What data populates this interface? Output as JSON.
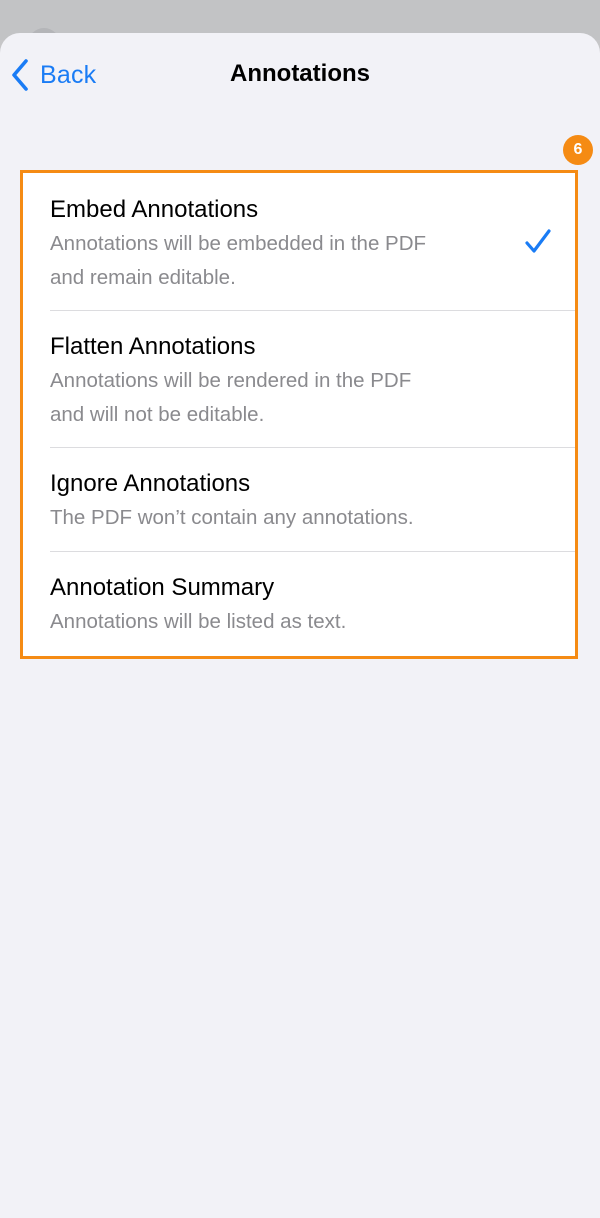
{
  "nav": {
    "back_label": "Back",
    "title": "Annotations"
  },
  "badge": "6",
  "options": [
    {
      "title": "Embed Annotations",
      "description_lines": [
        "Annotations will be embedded in the PDF",
        "and remain editable."
      ],
      "selected": true
    },
    {
      "title": "Flatten Annotations",
      "description_lines": [
        "Annotations will be rendered in the PDF",
        "and will not be editable."
      ],
      "selected": false
    },
    {
      "title": "Ignore Annotations",
      "description_lines": [
        "The PDF won’t contain any annotations."
      ],
      "selected": false
    },
    {
      "title": "Annotation Summary",
      "description_lines": [
        "Annotations will be listed as text."
      ],
      "selected": false
    }
  ],
  "icons": {
    "back": "chevron-left-icon",
    "selected": "checkmark-icon"
  },
  "colors": {
    "accent": "#1a7cf5",
    "highlight": "#f58b14",
    "background": "#f2f2f7",
    "secondary_text": "#8a8a8e"
  }
}
